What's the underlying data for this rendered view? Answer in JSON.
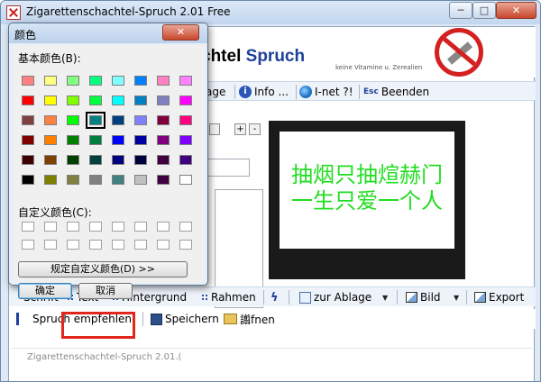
{
  "main_window": {
    "title": "Zigarettenschachtel-Spruch 2.01 Free",
    "caption_buttons": {
      "minimize": "─",
      "maximize": "□",
      "close": "✕"
    }
  },
  "banner": {
    "title_black": "chtel",
    "title_blue": "Spruch",
    "subtitle": "keine Vitamine u. Zerealien"
  },
  "menu": {
    "items": [
      {
        "label": "age",
        "icon": "none"
      },
      {
        "label": "Info ...",
        "icon": "info-icon"
      },
      {
        "label": "I-net ?!",
        "icon": "globe-icon"
      },
      {
        "label": "Beenden",
        "icon": "esc-icon",
        "icon_text": "Esc"
      }
    ]
  },
  "left_panel": {
    "plus": "+",
    "minus": "-"
  },
  "preview": {
    "line1": "抽烟只抽煊赫门",
    "line2": "一生只爱一个人",
    "text_color": "#22dd22"
  },
  "format_toolbar": {
    "schrift": "Schrift",
    "text": "Text",
    "hintergrund": "Hintergrund",
    "rahmen": "Rahmen",
    "zur_ablage": "zur Ablage",
    "bild": "Bild",
    "export": "Export"
  },
  "file_toolbar": {
    "spruch_empfehlen": "Spruch empfehlen",
    "speichern": "Speichern",
    "oeffnen": "譾fnen"
  },
  "status": {
    "text": "Zigarettenschachtel-Spruch 2.01.("
  },
  "color_dialog": {
    "title": "颜色",
    "close": "✕",
    "basic_label": "基本颜色(B):",
    "custom_label": "自定义颜色(C):",
    "define_button": "规定自定义颜色(D) >>",
    "ok_button": "确定",
    "cancel_button": "取消",
    "selected_index": 19,
    "basic_colors": [
      "#ff8080",
      "#ffff80",
      "#80ff80",
      "#00ff80",
      "#80ffff",
      "#0080ff",
      "#ff80c0",
      "#ff80ff",
      "#ff0000",
      "#ffff00",
      "#80ff00",
      "#00ff40",
      "#00ffff",
      "#0080c0",
      "#8080c0",
      "#ff00ff",
      "#804040",
      "#ff8040",
      "#00ff00",
      "#008080",
      "#004080",
      "#8080ff",
      "#800040",
      "#ff0080",
      "#800000",
      "#ff8000",
      "#008000",
      "#008040",
      "#0000ff",
      "#0000a0",
      "#800080",
      "#8000ff",
      "#400000",
      "#804000",
      "#004000",
      "#004040",
      "#000080",
      "#000040",
      "#400040",
      "#400080",
      "#000000",
      "#808000",
      "#808040",
      "#808080",
      "#408080",
      "#c0c0c0",
      "#400040",
      "#ffffff"
    ]
  }
}
